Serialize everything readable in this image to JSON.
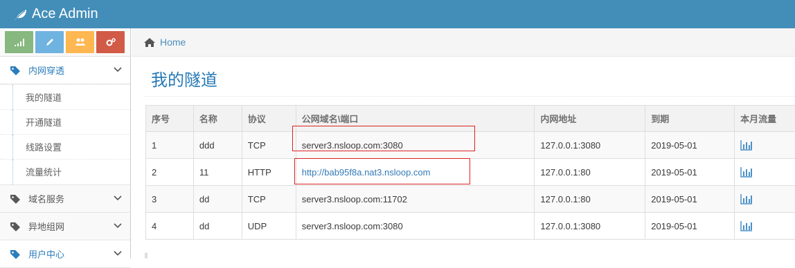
{
  "header": {
    "brand": "Ace Admin"
  },
  "colors": {
    "navbar": "#438eb9",
    "sc1": "#87b87f",
    "sc2": "#6fb3e0",
    "sc3": "#ffb752",
    "sc4": "#d15b47",
    "highlight": "#e02020"
  },
  "shortcuts": [
    {
      "icon": "signal-icon"
    },
    {
      "icon": "pencil-icon"
    },
    {
      "icon": "users-icon"
    },
    {
      "icon": "cogs-icon"
    }
  ],
  "sidebar": {
    "items": [
      {
        "label": "内网穿透",
        "icon": "tag-icon",
        "open": true
      },
      {
        "label": "域名服务",
        "icon": "tag-icon"
      },
      {
        "label": "异地组网",
        "icon": "tag-icon"
      },
      {
        "label": "用户中心",
        "icon": "tag-icon"
      }
    ],
    "submenu": [
      "我的隧道",
      "开通隧道",
      "线路设置",
      "流量统计"
    ]
  },
  "breadcrumb": {
    "home": "Home"
  },
  "page": {
    "title": "我的隧道"
  },
  "table": {
    "headers": [
      "序号",
      "名称",
      "协议",
      "公网域名\\端口",
      "内网地址",
      "到期",
      "本月流量"
    ],
    "rows": [
      [
        "1",
        "ddd",
        "TCP",
        "server3.nsloop.com:3080",
        "127.0.0.1:3080",
        "2019-05-01"
      ],
      [
        "2",
        "11",
        "HTTP",
        "http://bab95f8a.nat3.nsloop.com",
        "127.0.0.1:80",
        "2019-05-01"
      ],
      [
        "3",
        "dd",
        "TCP",
        "server3.nsloop.com:11702",
        "127.0.0.1:80",
        "2019-05-01"
      ],
      [
        "4",
        "dd",
        "UDP",
        "server3.nsloop.com:3080",
        "127.0.0.1:3080",
        "2019-05-01"
      ]
    ]
  }
}
